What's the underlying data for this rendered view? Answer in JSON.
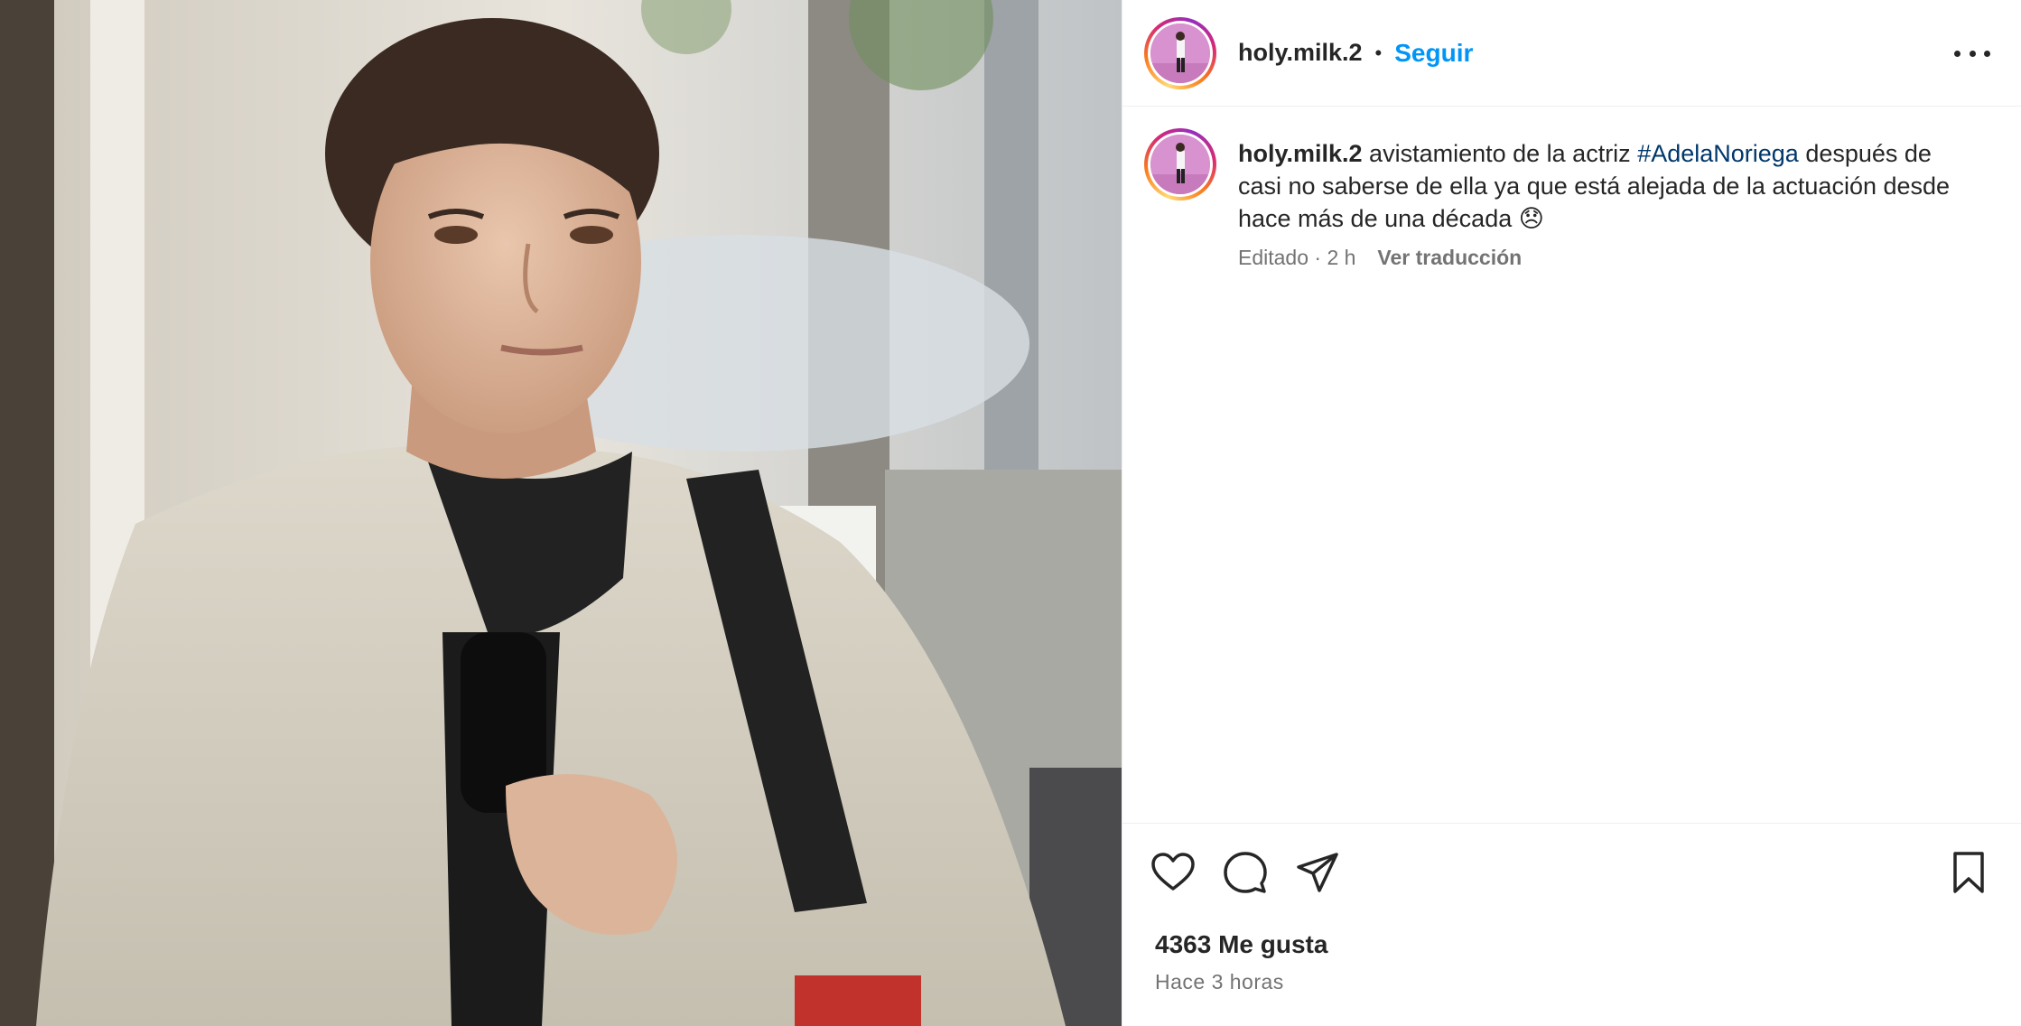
{
  "post": {
    "username": "holy.milk.2",
    "separator": "•",
    "follow_label": "Seguir",
    "more_icon": "more-horizontal-icon"
  },
  "caption": {
    "username": "holy.milk.2",
    "text_before": " avistamiento de la actriz ",
    "hashtag": "#AdelaNoriega",
    "text_after": " después de casi no saberse de ella ya que está alejada de la actuación desde hace más de una década ",
    "emoji": "😞",
    "edited": "Editado · 2 h",
    "translate_label": "Ver traducción"
  },
  "actions": {
    "like_icon": "heart-icon",
    "comment_icon": "comment-icon",
    "share_icon": "paper-plane-icon",
    "save_icon": "bookmark-icon"
  },
  "footer": {
    "likes": "4363 Me gusta",
    "timestamp": "Hace 3 horas"
  },
  "colors": {
    "link_blue": "#0095f6",
    "hashtag_navy": "#00376b",
    "text_primary": "#262626",
    "text_secondary": "#737373"
  }
}
